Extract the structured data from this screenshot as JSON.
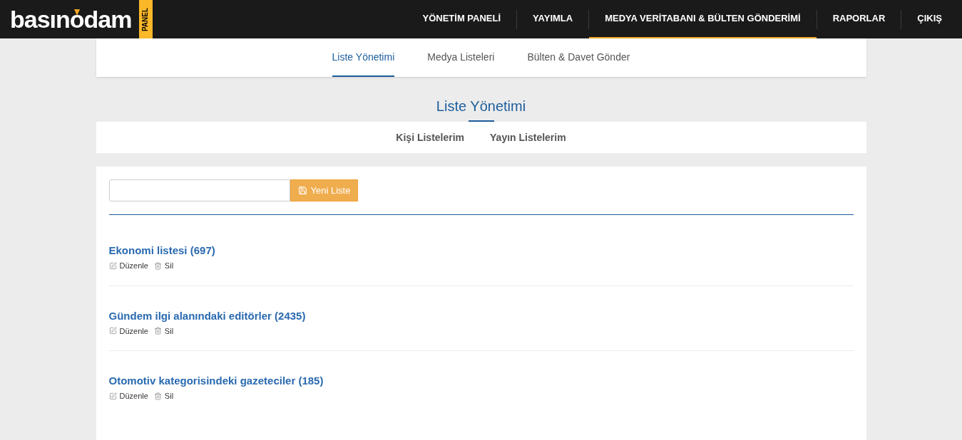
{
  "logo": {
    "text_start": "basın",
    "text_o": "o",
    "text_end": "dam",
    "tag": "PANEL"
  },
  "nav": [
    {
      "label": "YÖNETİM PANELİ",
      "selected": false
    },
    {
      "label": "YAYIMLA",
      "selected": false
    },
    {
      "label": "MEDYA VERİTABANI & BÜLTEN GÖNDERİMİ",
      "selected": true
    },
    {
      "label": "RAPORLAR",
      "selected": false
    },
    {
      "label": "ÇIKIŞ",
      "selected": false
    }
  ],
  "subtabs": [
    {
      "label": "Liste Yönetimi",
      "selected": true
    },
    {
      "label": "Medya Listeleri",
      "selected": false
    },
    {
      "label": "Bülten & Davet Gönder",
      "selected": false
    }
  ],
  "heading": "Liste Yönetimi",
  "list_tabs": [
    "Kişi Listelerim",
    "Yayın Listelerim"
  ],
  "new_list": {
    "button": "Yeni Liste"
  },
  "lists": [
    {
      "title": "Ekonomi listesi (697)",
      "edit": "Düzenle",
      "delete": "Sil"
    },
    {
      "title": "Gündem ilgi alanındaki editörler (2435)",
      "edit": "Düzenle",
      "delete": "Sil"
    },
    {
      "title": "Otomotiv kategorisindeki gazeteciler (185)",
      "edit": "Düzenle",
      "delete": "Sil"
    }
  ]
}
